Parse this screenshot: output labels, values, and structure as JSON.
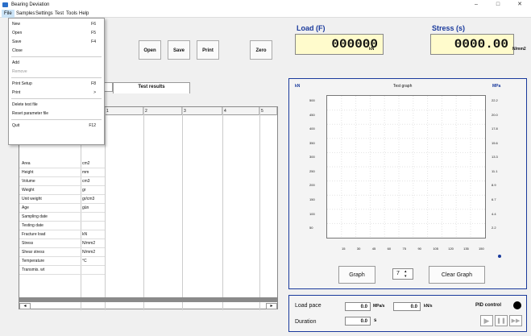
{
  "window": {
    "title": "Bearing Deviation"
  },
  "menubar": {
    "items": [
      "File",
      "Samples",
      "Settings",
      "Test",
      "Tools",
      "Help"
    ]
  },
  "file_menu": {
    "groups": [
      [
        {
          "label": "New",
          "shortcut": "F6"
        },
        {
          "label": "Open",
          "shortcut": "F5"
        },
        {
          "label": "Save",
          "shortcut": "F4"
        },
        {
          "label": "Close",
          "shortcut": ""
        }
      ],
      [
        {
          "label": "Add",
          "shortcut": ""
        },
        {
          "label": "Remove",
          "shortcut": ""
        }
      ],
      [
        {
          "label": "Print Setup",
          "shortcut": "F8"
        },
        {
          "label": "Print",
          "shortcut": ">"
        }
      ],
      [
        {
          "label": "Delete test file",
          "shortcut": ""
        },
        {
          "label": "Reset parameter file",
          "shortcut": ""
        }
      ],
      [
        {
          "label": "Quit",
          "shortcut": "F12"
        }
      ]
    ]
  },
  "toolbar": {
    "open": "Open",
    "save": "Save",
    "print": "Print",
    "zero": "Zero"
  },
  "load": {
    "label": "Load (F)",
    "value": "000000",
    "unit": "kN"
  },
  "stress": {
    "label": "Stress (s)",
    "value": "0000.00",
    "unit": "N/mm2"
  },
  "tabs": [
    "",
    "Test results"
  ],
  "table": {
    "columns": [
      "",
      "",
      "1",
      "2",
      "3",
      "4",
      "5"
    ],
    "rows": [
      {
        "label": "Area",
        "unit": "cm2"
      },
      {
        "label": "Height",
        "unit": "mm"
      },
      {
        "label": "Volume",
        "unit": "cm3"
      },
      {
        "label": "Weight",
        "unit": "gr"
      },
      {
        "label": "Unit weight",
        "unit": "gr/cm3"
      },
      {
        "label": "Age",
        "unit": "gün"
      },
      {
        "label": "Sampling date",
        "unit": ""
      },
      {
        "label": "Testing date",
        "unit": ""
      },
      {
        "label": "Fracture load",
        "unit": "kN"
      },
      {
        "label": "Stress",
        "unit": "N/mm2"
      },
      {
        "label": "Shear stress",
        "unit": "N/mm2"
      },
      {
        "label": "Temperature",
        "unit": "°C"
      },
      {
        "label": "Transmis. wt",
        "unit": ""
      }
    ]
  },
  "graph": {
    "title": "Test graph",
    "left_unit": "kN",
    "right_unit": "MPa",
    "left_ticks": [
      "500",
      "450",
      "400",
      "350",
      "300",
      "250",
      "200",
      "150",
      "100",
      "50"
    ],
    "right_ticks": [
      "22.2",
      "20.0",
      "17.8",
      "15.6",
      "13.3",
      "11.1",
      "8.9",
      "6.7",
      "4.4",
      "2.2"
    ],
    "x_ticks": [
      "15",
      "30",
      "45",
      "60",
      "75",
      "90",
      "105",
      "120",
      "135",
      "150"
    ],
    "graph_button": "Graph",
    "spinner_value": "7",
    "clear_button": "Clear Graph"
  },
  "controls": {
    "load_pace_label": "Load pace",
    "load_pace_value": "0.0",
    "load_pace_unit": "MPa/s",
    "load_pace_value2": "0.0",
    "load_pace_unit2": "kN/s",
    "duration_label": "Duration",
    "duration_value": "0.0",
    "duration_unit": "s",
    "pid_label": "PID control",
    "play": "▶",
    "pause": "❚❚",
    "ff": "▶▶"
  }
}
